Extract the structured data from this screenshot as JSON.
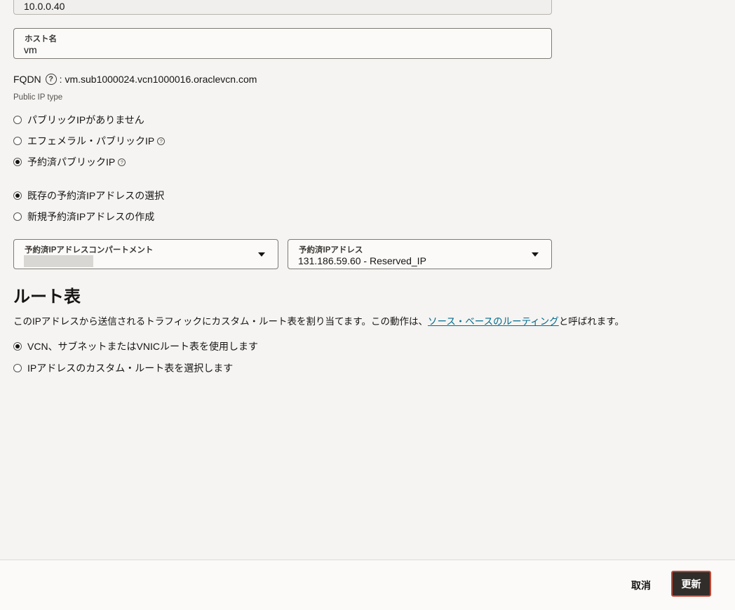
{
  "private_ip": {
    "value": "10.0.0.40"
  },
  "hostname": {
    "label": "ホスト名",
    "value": "vm"
  },
  "fqdn": {
    "label": "FQDN",
    "help_icon": "question-circle-icon",
    "value": ": vm.sub1000024.vcn1000016.oraclevcn.com"
  },
  "public_ip_type": {
    "label": "Public IP type",
    "options": [
      {
        "label": "パブリックIPがありません",
        "checked": false,
        "help": false
      },
      {
        "label": "エフェメラル・パブリックIP",
        "checked": false,
        "help": true
      },
      {
        "label": "予約済パブリックIP",
        "checked": true,
        "help": true
      }
    ]
  },
  "reserved_mode": {
    "options": [
      {
        "label": "既存の予約済IPアドレスの選択",
        "checked": true
      },
      {
        "label": "新規予約済IPアドレスの作成",
        "checked": false
      }
    ]
  },
  "compartment_select": {
    "label": "予約済IPアドレスコンパートメント",
    "value": ""
  },
  "reserved_ip_select": {
    "label": "予約済IPアドレス",
    "value": "131.186.59.60 - Reserved_IP"
  },
  "route_table": {
    "title": "ルート表",
    "desc_before": "このIPアドレスから送信されるトラフィックにカスタム・ルート表を割り当てます。この動作は、",
    "desc_link": "ソース・ベースのルーティング",
    "desc_after": "と呼ばれます。",
    "options": [
      {
        "label": "VCN、サブネットまたはVNICルート表を使用します",
        "checked": true
      },
      {
        "label": "IPアドレスのカスタム・ルート表を選択します",
        "checked": false
      }
    ]
  },
  "footer": {
    "cancel_label": "取消",
    "update_label": "更新"
  },
  "colors": {
    "primary_button": "#312d2a",
    "focus_ring": "#c74634",
    "link": "#006b8f"
  }
}
